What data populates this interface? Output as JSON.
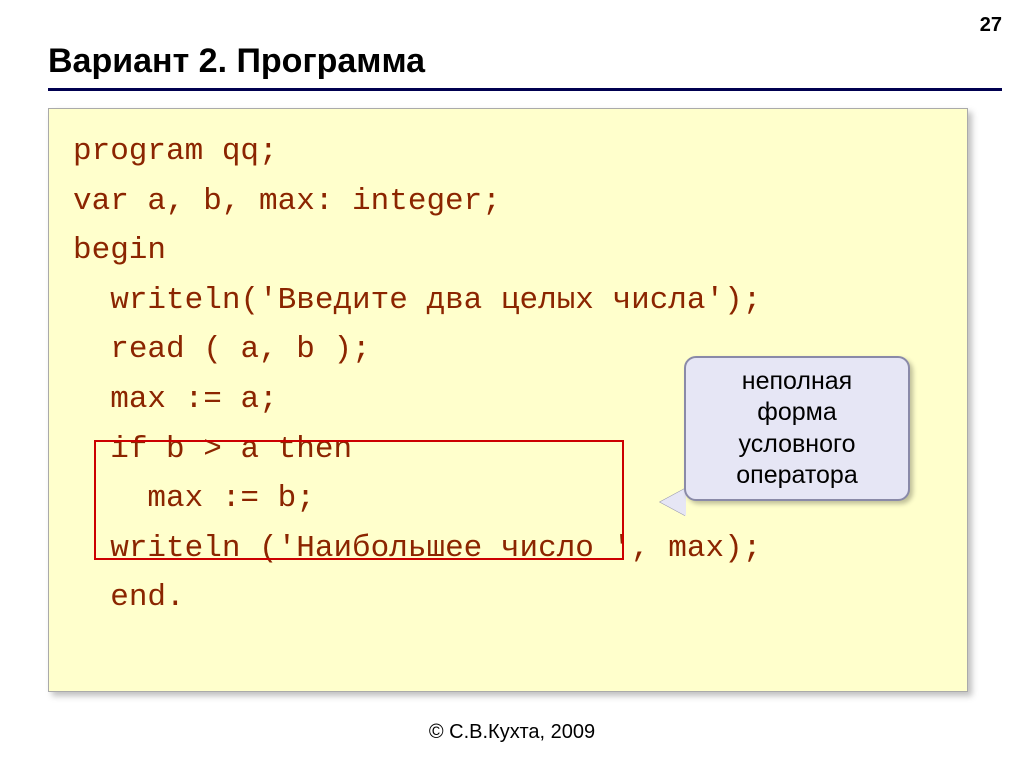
{
  "page_number": "27",
  "title": "Вариант 2. Программа",
  "code": {
    "line1": "program qq;",
    "line2": "var a, b, max: integer;",
    "line3": "begin",
    "line4": "  writeln('Введите два целых числа');",
    "line5": "  read ( a, b );",
    "line6": "  max := a;",
    "line7": "  if b > a then",
    "line8": "    max := b;",
    "line9": "  writeln ('Наибольшее число ', max);",
    "line10": "  end."
  },
  "callout": {
    "text_l1": "неполная",
    "text_l2": "форма",
    "text_l3": "условного",
    "text_l4": "оператора"
  },
  "footer": "© С.В.Кухта, 2009"
}
